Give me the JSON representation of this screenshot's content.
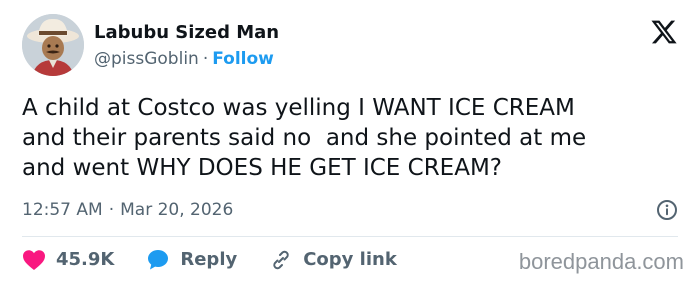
{
  "author": {
    "display_name": "Labubu Sized Man",
    "handle": "@pissGoblin",
    "separator": "·",
    "follow_label": "Follow"
  },
  "tweet": {
    "text": "A child at Costco was yelling I WANT ICE CREAM\nand their parents said no  and she pointed at me\nand went WHY DOES HE GET ICE CREAM?",
    "time": "12:57 AM",
    "separator": "·",
    "date": "Mar 20, 2026"
  },
  "actions": {
    "likes_count": "45.9K",
    "reply_label": "Reply",
    "copy_link_label": "Copy link"
  },
  "watermark": "boredpanda.com",
  "icons": {
    "brand": "x-logo-icon",
    "info": "info-icon",
    "like": "heart-icon",
    "reply": "reply-bubble-icon",
    "copy": "link-icon"
  },
  "colors": {
    "accent": "#1d9bf0",
    "like": "#f91880",
    "text": "#0f1419",
    "muted": "#536471"
  }
}
